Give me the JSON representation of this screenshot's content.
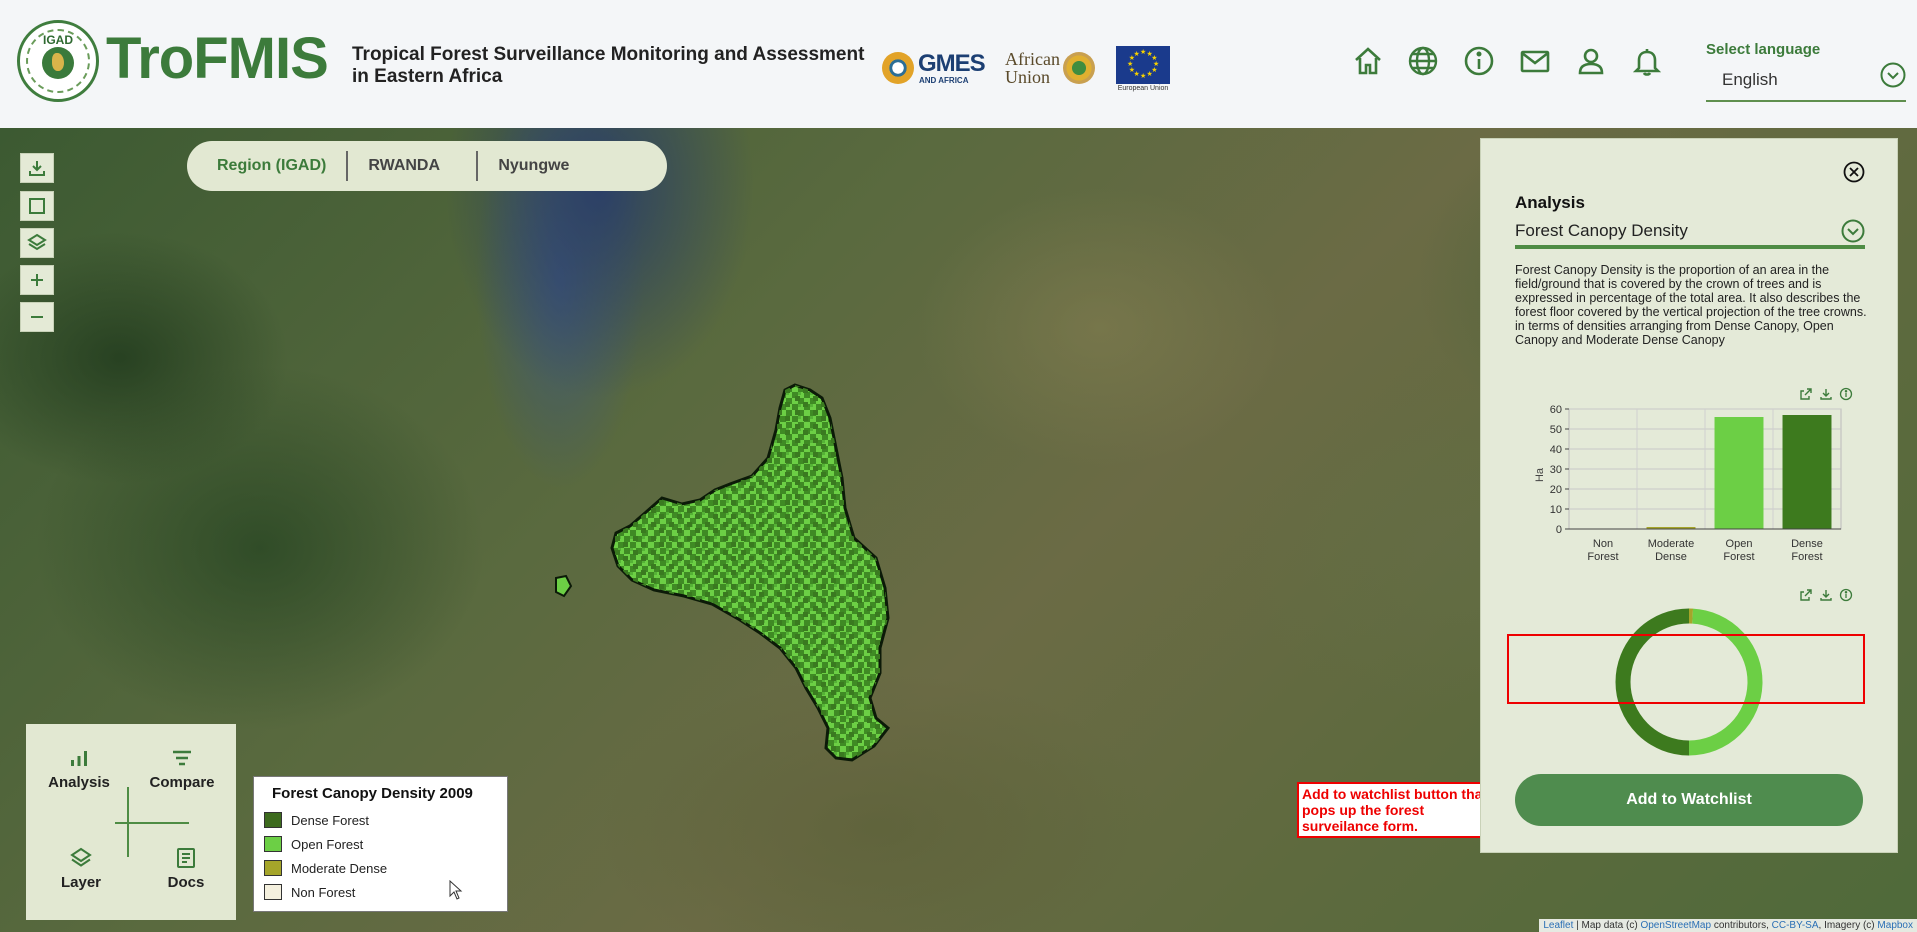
{
  "header": {
    "logo_text": "IGAD",
    "brand": "TroFMIS",
    "subtitle": "Tropical Forest Surveillance Monitoring and Assessment in Eastern Africa",
    "partners": {
      "gmes": "GMES",
      "gmes_sub": "AND AFRICA",
      "au": "African Union",
      "eu": "European Union"
    },
    "icons": [
      "home-icon",
      "globe-icon",
      "info-icon",
      "mail-icon",
      "user-icon",
      "bell-icon"
    ],
    "language_label": "Select language",
    "language_value": "English"
  },
  "breadcrumb": {
    "items": [
      "Region (IGAD)",
      "RWANDA",
      "Nyungwe"
    ]
  },
  "map_tools": [
    "download-icon",
    "draw-rectangle-icon",
    "layers-icon",
    "zoom-in-icon",
    "zoom-out-icon"
  ],
  "menu": {
    "analysis": "Analysis",
    "compare": "Compare",
    "layer": "Layer",
    "docs": "Docs"
  },
  "legend": {
    "title": "Forest Canopy Density 2009",
    "items": [
      {
        "label": "Dense Forest",
        "color": "#3d6b1e"
      },
      {
        "label": "Open Forest",
        "color": "#6ccf45"
      },
      {
        "label": "Moderate Dense",
        "color": "#a5a52a"
      },
      {
        "label": "Non Forest",
        "color": "#f4f0de"
      }
    ]
  },
  "annotation": "Add to watchlist button that pops up the forest surveilance form.",
  "attribution": {
    "leaflet": "Leaflet",
    "data_pre": " | Map data (c) ",
    "osm": "OpenStreetMap",
    "mid": " contributors, ",
    "ccbysa": "CC-BY-SA",
    "imagery": ", Imagery (c) ",
    "mapbox": "Mapbox"
  },
  "panel": {
    "title": "Analysis",
    "selected": "Forest Canopy Density",
    "description": "Forest Canopy Density is the proportion of an area in the field/ground that is covered by the crown of trees and is expressed in percentage of the total area. It also describes the forest floor covered by the vertical projection of the tree crowns. in terms of densities arranging from Dense Canopy, Open Canopy and Moderate Dense Canopy",
    "button": "Add to Watchlist"
  },
  "chart_data": [
    {
      "type": "bar",
      "categories": [
        "Non Forest",
        "Moderate Dense",
        "Open Forest",
        "Dense Forest"
      ],
      "values": [
        0,
        1,
        56,
        57
      ],
      "colors": [
        "#f4f0de",
        "#a5a52a",
        "#6ccf45",
        "#3d7a1e"
      ],
      "ylabel": "Ha",
      "ylim": [
        0,
        60
      ],
      "yticks": [
        0,
        10,
        20,
        30,
        40,
        50,
        60
      ],
      "grid": true
    },
    {
      "type": "pie",
      "categories": [
        "Non Forest",
        "Moderate Dense",
        "Open Forest",
        "Dense Forest"
      ],
      "values": [
        0,
        1,
        56,
        57
      ],
      "colors": [
        "#f4f0de",
        "#a5a52a",
        "#6ccf45",
        "#3d7a1e"
      ]
    }
  ]
}
